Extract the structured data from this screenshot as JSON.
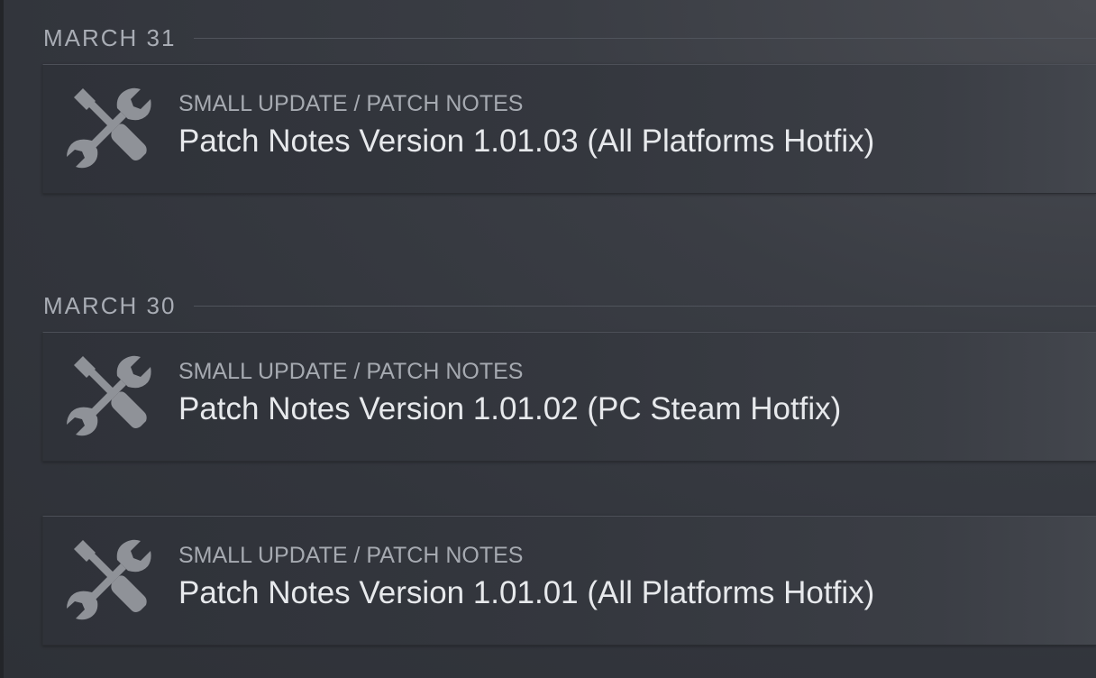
{
  "sections": [
    {
      "date": "MARCH 31",
      "events": [
        {
          "icon": "tools-icon",
          "category": "SMALL UPDATE / PATCH NOTES",
          "title": "Patch Notes Version 1.01.03 (All Platforms Hotfix)"
        }
      ]
    },
    {
      "date": "MARCH 30",
      "events": [
        {
          "icon": "tools-icon",
          "category": "SMALL UPDATE / PATCH NOTES",
          "title": "Patch Notes Version 1.01.02 (PC Steam Hotfix)"
        },
        {
          "icon": "tools-icon",
          "category": "SMALL UPDATE / PATCH NOTES",
          "title": "Patch Notes Version 1.01.01 (All Platforms Hotfix)"
        }
      ]
    }
  ]
}
